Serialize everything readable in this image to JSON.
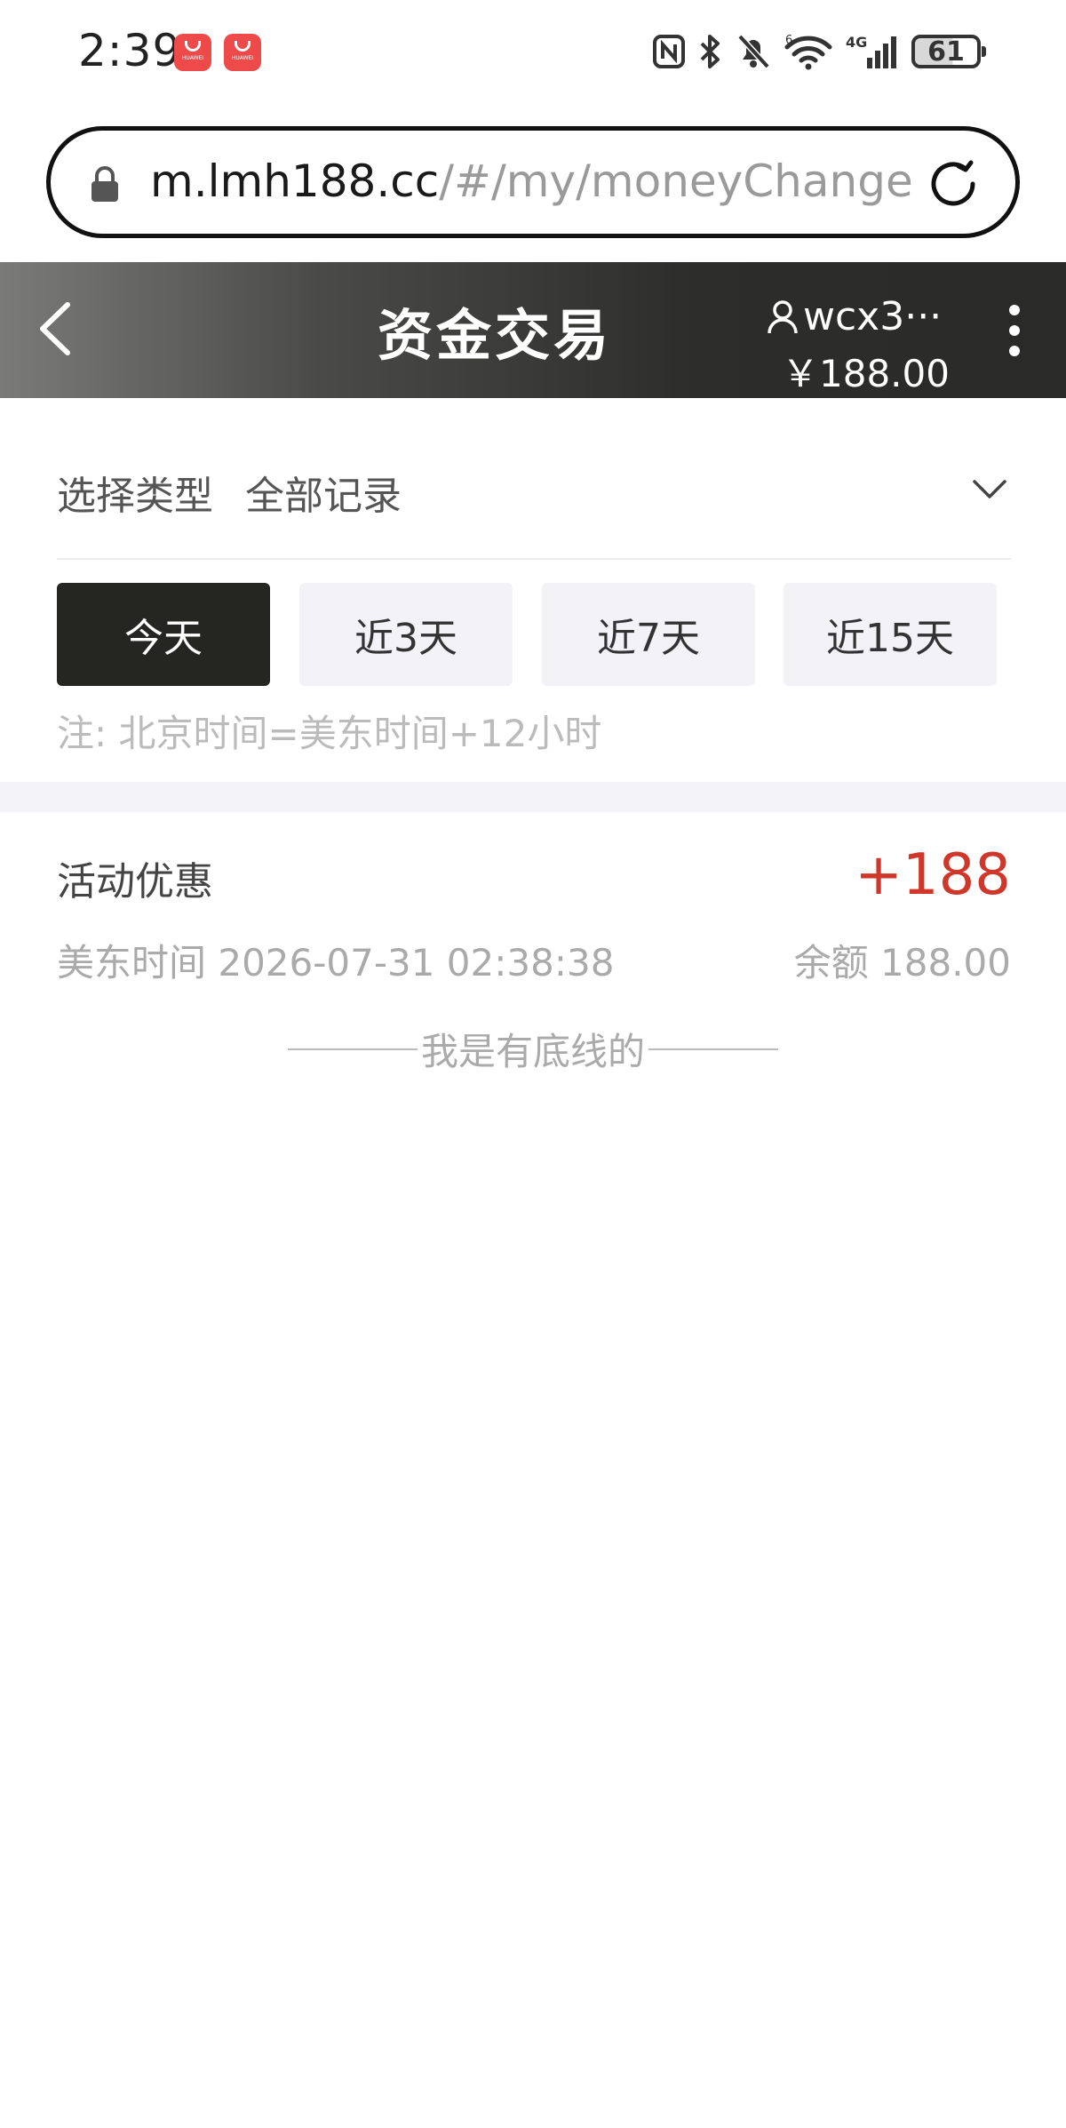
{
  "status_bar": {
    "time": "2:39",
    "app_badges": [
      "HUAWEI",
      "HUAWEI"
    ],
    "battery_level": "61",
    "network_label": "4G",
    "wifi_label": "6"
  },
  "browser": {
    "url_host": "m.lmh188.cc",
    "url_path": "/#/my/moneyChange"
  },
  "header": {
    "title": "资金交易",
    "username": "wcx3···",
    "balance": "￥188.00"
  },
  "filter": {
    "type_label": "选择类型",
    "type_value": "全部记录"
  },
  "range_tabs": [
    {
      "label": "今天",
      "active": true
    },
    {
      "label": "近3天",
      "active": false
    },
    {
      "label": "近7天",
      "active": false
    },
    {
      "label": "近15天",
      "active": false
    }
  ],
  "note": "注:  北京时间=美东时间+12小时",
  "records": [
    {
      "type": "活动优惠",
      "amount": "+188",
      "time": "美东时间 2026-07-31 02:38:38",
      "balance": "余额 188.00"
    }
  ],
  "end_text": "我是有底线的",
  "colors": {
    "accent_red": "#d0372b",
    "active_tab": "#252522",
    "tab_bg": "#f3f3f7"
  }
}
